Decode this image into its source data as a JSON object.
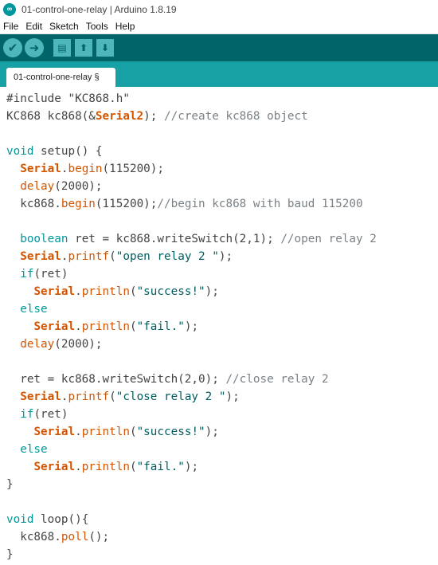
{
  "window": {
    "title": "01-control-one-relay | Arduino 1.8.19"
  },
  "menu": [
    "File",
    "Edit",
    "Sketch",
    "Tools",
    "Help"
  ],
  "toolbar": [
    {
      "name": "verify",
      "icon": "check-icon"
    },
    {
      "name": "upload",
      "icon": "arrow-right-icon"
    },
    {
      "name": "new",
      "icon": "new-file-icon"
    },
    {
      "name": "open",
      "icon": "arrow-up-icon"
    },
    {
      "name": "save",
      "icon": "arrow-down-icon"
    }
  ],
  "tab": {
    "label": "01-control-one-relay §"
  },
  "colors": {
    "toolbar": "#006468",
    "tabbar": "#17a1a5",
    "keyword": "#00979c",
    "function": "#d35400",
    "comment": "#7a8186"
  },
  "code": [
    [
      [
        "pp",
        "#include \"KC868.h\""
      ]
    ],
    [
      [
        "t",
        "KC868 kc868(&"
      ],
      [
        "obj",
        "Serial2"
      ],
      [
        "t",
        "); "
      ],
      [
        "cm",
        "//create kc868 object"
      ]
    ],
    [],
    [
      [
        "kw",
        "void"
      ],
      [
        "t",
        " setup() {"
      ]
    ],
    [
      [
        "t",
        "  "
      ],
      [
        "obj",
        "Serial"
      ],
      [
        "t",
        "."
      ],
      [
        "fn",
        "begin"
      ],
      [
        "t",
        "(115200);"
      ]
    ],
    [
      [
        "t",
        "  "
      ],
      [
        "fn",
        "delay"
      ],
      [
        "t",
        "(2000);"
      ]
    ],
    [
      [
        "t",
        "  kc868."
      ],
      [
        "fn",
        "begin"
      ],
      [
        "t",
        "(115200);"
      ],
      [
        "cm",
        "//begin kc868 with baud 115200"
      ]
    ],
    [],
    [
      [
        "t",
        "  "
      ],
      [
        "kw",
        "boolean"
      ],
      [
        "t",
        " ret = kc868.writeSwitch(2,1); "
      ],
      [
        "cm",
        "//open relay 2"
      ]
    ],
    [
      [
        "t",
        "  "
      ],
      [
        "obj",
        "Serial"
      ],
      [
        "t",
        "."
      ],
      [
        "fn",
        "printf"
      ],
      [
        "t",
        "("
      ],
      [
        "st",
        "\"open relay 2 \""
      ],
      [
        "t",
        ");"
      ]
    ],
    [
      [
        "t",
        "  "
      ],
      [
        "kw",
        "if"
      ],
      [
        "t",
        "(ret)"
      ]
    ],
    [
      [
        "t",
        "    "
      ],
      [
        "obj",
        "Serial"
      ],
      [
        "t",
        "."
      ],
      [
        "fn",
        "println"
      ],
      [
        "t",
        "("
      ],
      [
        "st",
        "\"success!\""
      ],
      [
        "t",
        ");"
      ]
    ],
    [
      [
        "t",
        "  "
      ],
      [
        "kw",
        "else"
      ]
    ],
    [
      [
        "t",
        "    "
      ],
      [
        "obj",
        "Serial"
      ],
      [
        "t",
        "."
      ],
      [
        "fn",
        "println"
      ],
      [
        "t",
        "("
      ],
      [
        "st",
        "\"fail.\""
      ],
      [
        "t",
        ");"
      ]
    ],
    [
      [
        "t",
        "  "
      ],
      [
        "fn",
        "delay"
      ],
      [
        "t",
        "(2000);"
      ]
    ],
    [],
    [
      [
        "t",
        "  ret = kc868.writeSwitch(2,0); "
      ],
      [
        "cm",
        "//close relay 2"
      ]
    ],
    [
      [
        "t",
        "  "
      ],
      [
        "obj",
        "Serial"
      ],
      [
        "t",
        "."
      ],
      [
        "fn",
        "printf"
      ],
      [
        "t",
        "("
      ],
      [
        "st",
        "\"close relay 2 \""
      ],
      [
        "t",
        ");"
      ]
    ],
    [
      [
        "t",
        "  "
      ],
      [
        "kw",
        "if"
      ],
      [
        "t",
        "(ret)"
      ]
    ],
    [
      [
        "t",
        "    "
      ],
      [
        "obj",
        "Serial"
      ],
      [
        "t",
        "."
      ],
      [
        "fn",
        "println"
      ],
      [
        "t",
        "("
      ],
      [
        "st",
        "\"success!\""
      ],
      [
        "t",
        ");"
      ]
    ],
    [
      [
        "t",
        "  "
      ],
      [
        "kw",
        "else"
      ]
    ],
    [
      [
        "t",
        "    "
      ],
      [
        "obj",
        "Serial"
      ],
      [
        "t",
        "."
      ],
      [
        "fn",
        "println"
      ],
      [
        "t",
        "("
      ],
      [
        "st",
        "\"fail.\""
      ],
      [
        "t",
        ");"
      ]
    ],
    [
      [
        "t",
        "}"
      ]
    ],
    [],
    [
      [
        "kw",
        "void"
      ],
      [
        "t",
        " loop(){"
      ]
    ],
    [
      [
        "t",
        "  kc868."
      ],
      [
        "fn",
        "poll"
      ],
      [
        "t",
        "();"
      ]
    ],
    [
      [
        "t",
        "}"
      ]
    ]
  ]
}
